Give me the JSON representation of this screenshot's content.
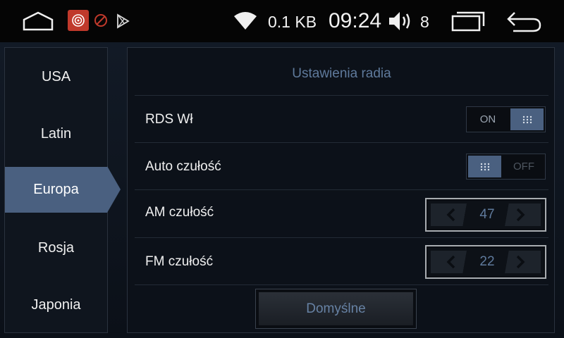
{
  "status_bar": {
    "net_speed": "0.1 KB",
    "time": "09:24",
    "volume": "8",
    "icons": [
      "home-icon",
      "app-icon",
      "block-icon",
      "play-store-icon",
      "wifi-icon",
      "volume-icon",
      "recents-icon",
      "back-icon"
    ]
  },
  "sidebar": {
    "items": [
      {
        "label": "USA",
        "active": false
      },
      {
        "label": "Latin",
        "active": false
      },
      {
        "label": "Europa",
        "active": true
      },
      {
        "label": "Rosja",
        "active": false
      },
      {
        "label": "Japonia",
        "active": false
      }
    ]
  },
  "panel": {
    "title": "Ustawienia radia",
    "rds": {
      "label": "RDS Wł",
      "on_label": "ON",
      "state": "on"
    },
    "auto_sensitivity": {
      "label": "Auto czułość",
      "off_label": "OFF",
      "state": "on"
    },
    "am_sensitivity": {
      "label": "AM czułość",
      "value": "47"
    },
    "fm_sensitivity": {
      "label": "FM czułość",
      "value": "22"
    },
    "default_button": "Domyślne"
  },
  "colors": {
    "accent": "#4a6080",
    "title_text": "#5f7a9c",
    "app_icon_red": "#c0392b"
  }
}
